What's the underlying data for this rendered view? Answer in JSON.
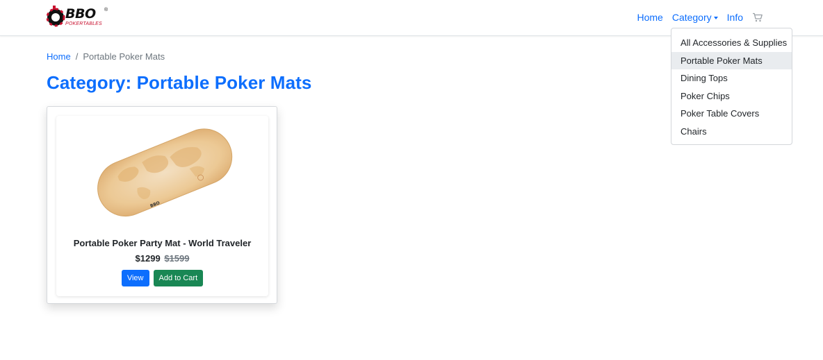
{
  "brand": {
    "name": "BBO",
    "registered": "®",
    "tagline": "POKERTABLES",
    "colors": {
      "red": "#c8102e",
      "black": "#111111"
    }
  },
  "nav": {
    "home": "Home",
    "category": "Category",
    "info": "Info",
    "cart_icon": "shopping-cart-icon"
  },
  "dropdown": {
    "items": [
      "All Accessories & Supplies",
      "Portable Poker Mats",
      "Dining Tops",
      "Poker Chips",
      "Poker Table Covers",
      "Chairs"
    ],
    "active_index": 1
  },
  "breadcrumb": {
    "home": "Home",
    "separator": "/",
    "current": "Portable Poker Mats"
  },
  "page": {
    "title": "Category: Portable Poker Mats"
  },
  "product": {
    "name": "Portable Poker Party Mat - World Traveler",
    "price": "$1299",
    "old_price": "$1599",
    "view_label": "View",
    "add_label": "Add to Cart",
    "mat_logo": "BBO"
  },
  "colors": {
    "primary": "#0d6efd",
    "success": "#198754",
    "muted": "#6c757d"
  }
}
